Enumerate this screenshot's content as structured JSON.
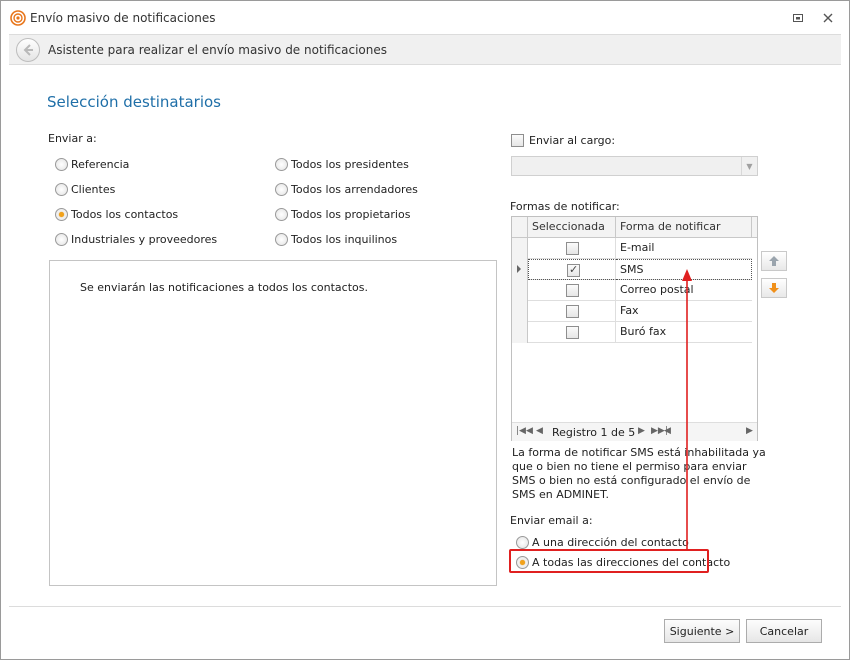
{
  "window": {
    "title": "Envío masivo de notificaciones",
    "header": "Asistente para realizar el envío masivo de notificaciones"
  },
  "page_title": "Selección destinatarios",
  "send_to": {
    "label": "Enviar a:",
    "options": [
      {
        "label": "Referencia",
        "checked": false
      },
      {
        "label": "Clientes",
        "checked": false
      },
      {
        "label": "Todos los contactos",
        "checked": true
      },
      {
        "label": "Industriales y proveedores",
        "checked": false
      },
      {
        "label": "Todos los presidentes",
        "checked": false
      },
      {
        "label": "Todos los arrendadores",
        "checked": false
      },
      {
        "label": "Todos los propietarios",
        "checked": false
      },
      {
        "label": "Todos los inquilinos",
        "checked": false
      }
    ],
    "message": "Se enviarán las notificaciones a todos los contactos."
  },
  "send_to_role": {
    "label": "Enviar al cargo:",
    "checked": false,
    "value": ""
  },
  "notify_forms": {
    "label": "Formas de notificar:",
    "columns": [
      "Seleccionada",
      "Forma de notificar"
    ],
    "rows": [
      {
        "form": "E-mail",
        "selected": false
      },
      {
        "form": "SMS",
        "selected": true
      },
      {
        "form": "Correo postal",
        "selected": false
      },
      {
        "form": "Fax",
        "selected": false
      },
      {
        "form": "Buró fax",
        "selected": false
      }
    ],
    "navigator": "Registro 1 de 5"
  },
  "sms_note": "La forma de notificar SMS está inhabilitada ya que o bien no tiene el permiso para enviar SMS o bien no está configurado el envío de SMS en ADMINET.",
  "email_to": {
    "label": "Enviar email a:",
    "options": [
      {
        "label": "A una dirección del contacto",
        "checked": false
      },
      {
        "label": "A todas las direcciones del contacto",
        "checked": true
      }
    ]
  },
  "footer": {
    "next_label": "Siguiente >",
    "cancel_label": "Cancelar"
  },
  "colors": {
    "accent": "#1f6fa8",
    "radio_selected": "#f2a21a",
    "annotation": "#e02020",
    "move_up": "#9aa4ad",
    "move_down": "#f0901a"
  },
  "icons": {
    "app": "broadcast-icon",
    "back": "back-arrow-icon",
    "restore": "restore-icon",
    "close": "close-icon",
    "move_up": "arrow-up-icon",
    "move_down": "arrow-down-icon"
  }
}
